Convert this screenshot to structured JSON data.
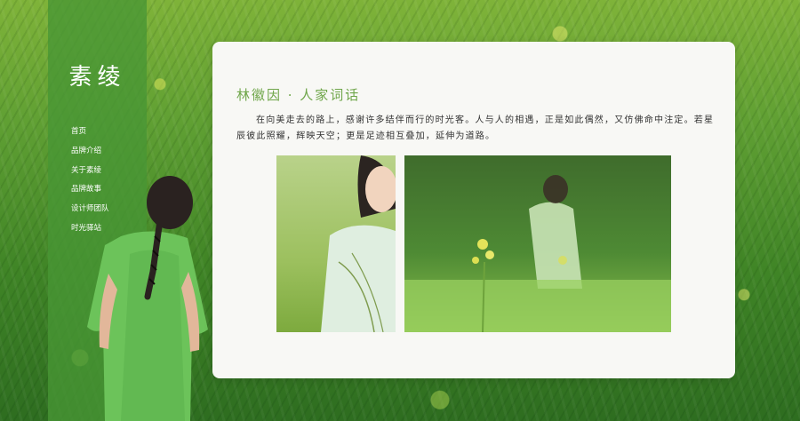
{
  "brand": {
    "logo": "素绫"
  },
  "nav": {
    "items": [
      {
        "label": "首页"
      },
      {
        "label": "品牌介绍"
      },
      {
        "label": "关于素绫"
      },
      {
        "label": "品牌故事"
      },
      {
        "label": "设计师团队"
      },
      {
        "label": "时光驿站"
      }
    ]
  },
  "article": {
    "title": "林徽因 · 人家词话",
    "paragraph": "在向美走去的路上，感谢许多结伴而行的时光客。人与人的相遇，正是如此偶然，又仿佛命中注定。若星辰彼此照耀，辉映天空；更是足迹相互叠加，延伸为道路。"
  },
  "colors": {
    "accent": "#6fa64a",
    "sideband": "#48963a",
    "card": "#f8f8f5"
  }
}
